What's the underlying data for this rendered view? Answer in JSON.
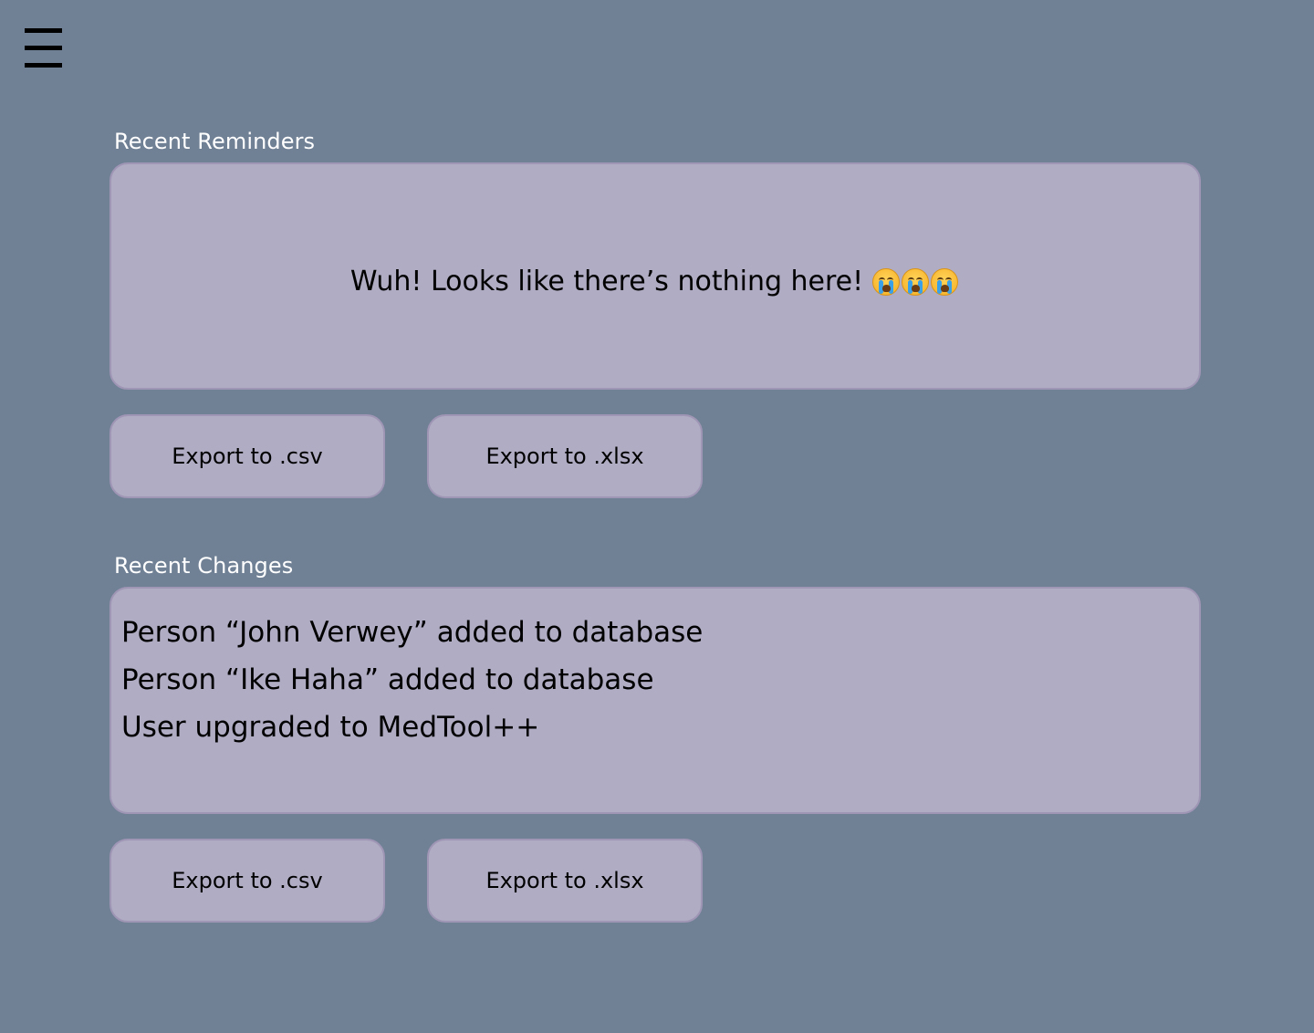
{
  "header": {
    "menu_icon": "hamburger-menu-icon"
  },
  "reminders": {
    "label": "Recent Reminders",
    "empty_message": "Wuh! Looks like there’s nothing here!",
    "emoji_icon": "loudly-crying-face-icon",
    "emoji_count": 3,
    "export_csv_label": "Export to .csv",
    "export_xlsx_label": "Export to .xlsx"
  },
  "changes": {
    "label": "Recent Changes",
    "items": [
      "Person “John Verwey” added to database",
      "Person “Ike Haha” added to database",
      "User upgraded to MedTool++"
    ],
    "export_csv_label": "Export to .csv",
    "export_xlsx_label": "Export to .xlsx"
  },
  "colors": {
    "background": "#708095",
    "panel": "#afacc3",
    "panel_border": "#9f95b4",
    "label_text": "#ffffff"
  }
}
